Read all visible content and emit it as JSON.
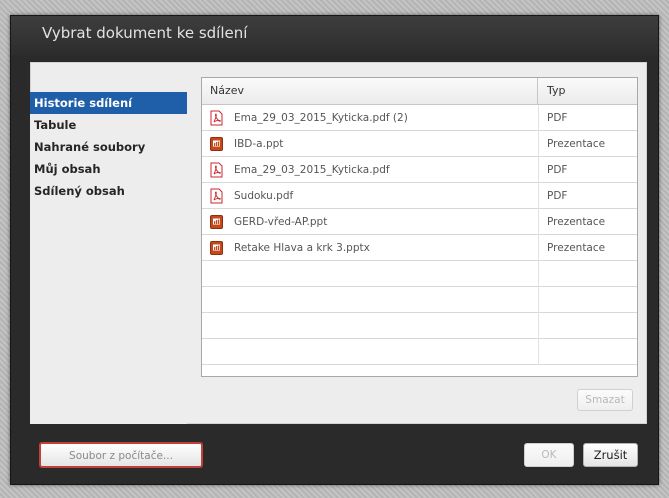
{
  "dialog": {
    "title": "Vybrat dokument ke sdílení"
  },
  "sidebar": {
    "items": [
      {
        "label": "Historie sdílení",
        "selected": true
      },
      {
        "label": "Tabule",
        "selected": false
      },
      {
        "label": "Nahrané soubory",
        "selected": false
      },
      {
        "label": "Můj obsah",
        "selected": false
      },
      {
        "label": "Sdílený obsah",
        "selected": false
      }
    ]
  },
  "table": {
    "columns": {
      "name": "Název",
      "type": "Typ"
    },
    "rows": [
      {
        "icon": "pdf-file-icon",
        "name": "Ema_29_03_2015_Kyticka.pdf (2)",
        "type": "PDF"
      },
      {
        "icon": "ppt-file-icon",
        "name": "IBD-a.ppt",
        "type": "Prezentace"
      },
      {
        "icon": "pdf-file-icon",
        "name": "Ema_29_03_2015_Kyticka.pdf",
        "type": "PDF"
      },
      {
        "icon": "pdf-file-icon",
        "name": "Sudoku.pdf",
        "type": "PDF"
      },
      {
        "icon": "ppt-file-icon",
        "name": "GERD-vřed-AP.ppt",
        "type": "Prezentace"
      },
      {
        "icon": "ppt-file-icon",
        "name": "Retake Hlava a krk 3.pptx",
        "type": "Prezentace"
      }
    ]
  },
  "buttons": {
    "delete": "Smazat",
    "from_computer": "Soubor z počítače...",
    "ok": "OK",
    "cancel": "Zrušit"
  },
  "colors": {
    "selection": "#1f5ea8",
    "highlight_border": "#c0413a",
    "pdf_icon": "#c8282d",
    "ppt_icon": "#c44a1e"
  }
}
